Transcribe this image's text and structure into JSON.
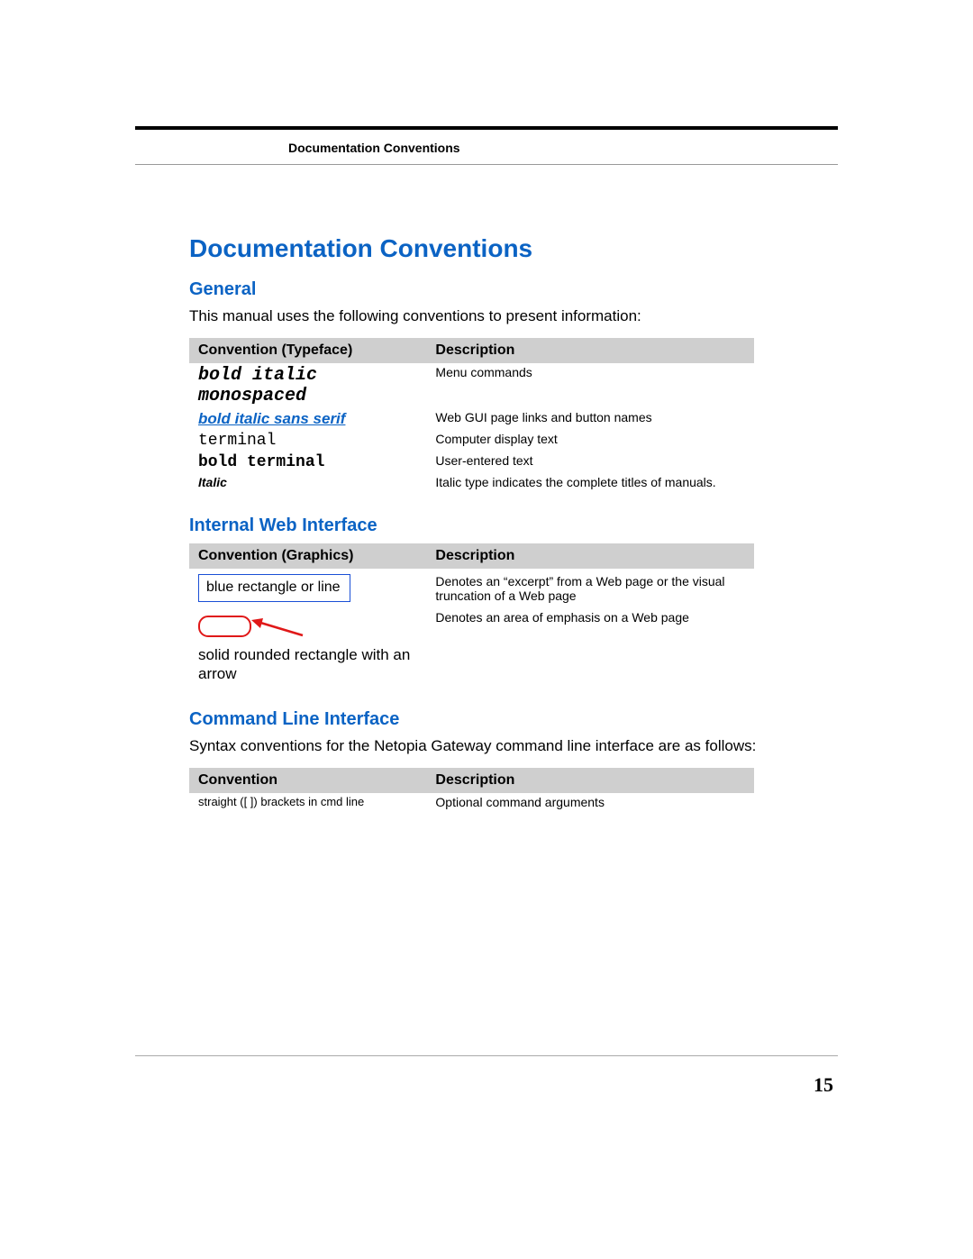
{
  "header": {
    "label": "Documentation Conventions"
  },
  "title": "Documentation Conventions",
  "general": {
    "heading": "General",
    "intro": "This manual uses the following conventions to present information:",
    "headers": {
      "left": "Convention (Typeface)",
      "right": "Description"
    },
    "rows": [
      {
        "typeface_line1": "bold italic",
        "typeface_line2": "monospaced",
        "desc": "Menu commands"
      },
      {
        "typeface": "bold italic sans serif",
        "desc": "Web GUI page links and button names"
      },
      {
        "typeface": "terminal",
        "desc": "Computer display text"
      },
      {
        "typeface": "bold terminal",
        "desc": "User-entered text"
      },
      {
        "typeface": "Italic",
        "desc": "Italic type indicates the complete titles of manuals."
      }
    ]
  },
  "internal": {
    "heading": "Internal Web Interface",
    "headers": {
      "left": "Convention (Graphics)",
      "right": "Description"
    },
    "rows": [
      {
        "graphic": "blue rectangle or line",
        "desc": "Denotes an “excerpt” from a Web page or the visual truncation of a Web page"
      },
      {
        "graphic_label": "solid rounded rectangle with an arrow",
        "desc": "Denotes an area of emphasis on a Web page"
      }
    ]
  },
  "cli": {
    "heading": "Command Line Interface",
    "intro": "Syntax conventions for the Netopia Gateway command line interface are as follows:",
    "headers": {
      "left": "Convention",
      "right": "Description"
    },
    "rows": [
      {
        "conv": "straight ([ ]) brackets in cmd line",
        "desc": "Optional command arguments"
      }
    ]
  },
  "page_number": "15"
}
